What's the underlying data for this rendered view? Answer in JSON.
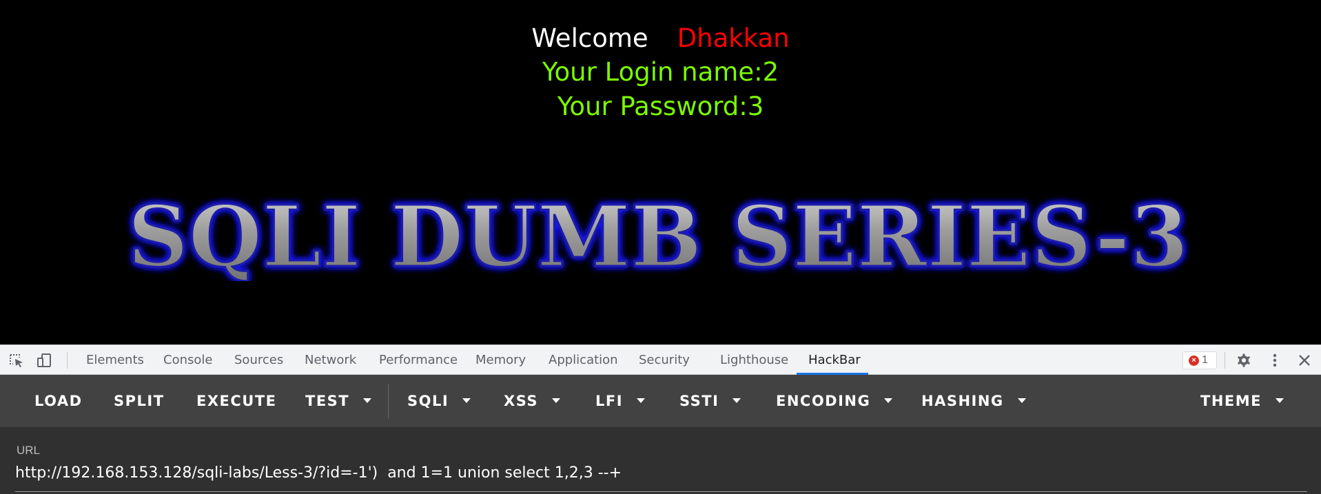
{
  "page": {
    "welcome_label": "Welcome",
    "welcome_name": "Dhakkan",
    "login_line": "Your Login name:2",
    "password_line": "Your Password:3",
    "banner_text": "SQLI DUMB SERIES-3",
    "colors": {
      "background": "#000000",
      "welcome": "#ffffff",
      "name": "#ff0000",
      "credentials": "#7cfc00",
      "banner_glow": "#1a1aff",
      "banner_fill": "#a9a9a9"
    }
  },
  "devtools": {
    "icons": [
      "inspect-element-icon",
      "device-toolbar-icon",
      "settings-gear-icon",
      "more-vertical-icon",
      "close-icon"
    ],
    "tabs": [
      "Elements",
      "Console",
      "Sources",
      "Network",
      "Performance",
      "Memory",
      "Application",
      "Security",
      "Lighthouse",
      "HackBar"
    ],
    "active_tab": "HackBar",
    "error_count": "1",
    "colors": {
      "tabbar_bg": "#f1f3f4",
      "active_underline": "#1a73e8",
      "error_red": "#d93025"
    }
  },
  "hackbar": {
    "buttons": [
      "LOAD",
      "SPLIT",
      "EXECUTE"
    ],
    "dropdowns": [
      "TEST",
      "SQLI",
      "XSS",
      "LFI",
      "SSTI",
      "ENCODING",
      "HASHING"
    ],
    "theme_label": "THEME",
    "url_label": "URL",
    "url_value": "http://192.168.153.128/sqli-labs/Less-3/?id=-1')  and 1=1 union select 1,2,3 --+",
    "colors": {
      "toolbar_bg": "#424242",
      "panel_bg": "#303030",
      "text": "#ffffff"
    }
  }
}
